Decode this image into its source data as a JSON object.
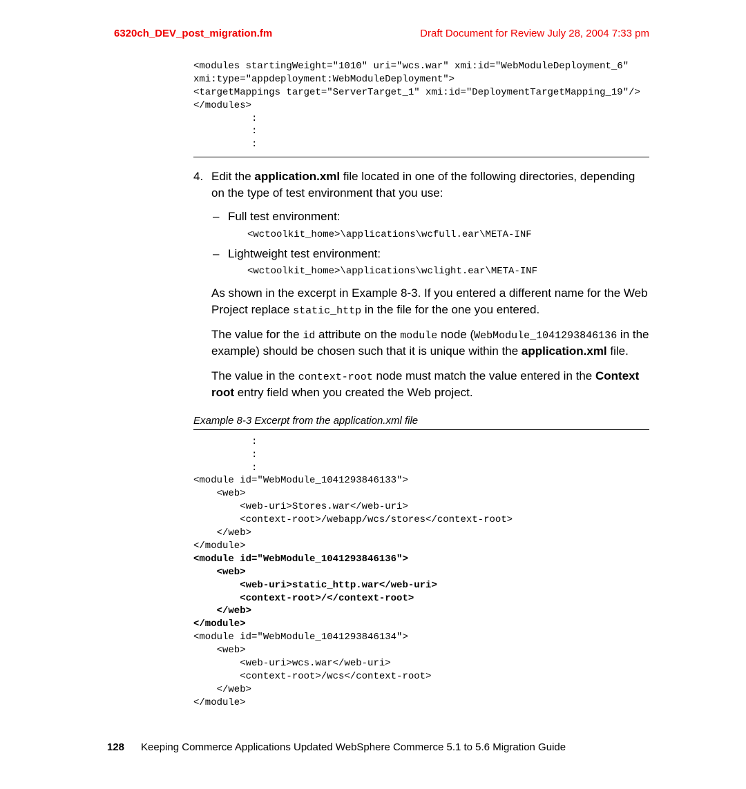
{
  "header": {
    "left": "6320ch_DEV_post_migration.fm",
    "right": "Draft Document for Review July 28, 2004 7:33 pm"
  },
  "code1": {
    "l1": "<modules startingWeight=\"1010\" uri=\"wcs.war\" xmi:id=\"WebModuleDeployment_6\" ",
    "l2": "xmi:type=\"appdeployment:WebModuleDeployment\">",
    "l3": "<targetMappings target=\"ServerTarget_1\" xmi:id=\"DeploymentTargetMapping_19\"/>",
    "l4": "</modules>",
    "d1": "          :",
    "d2": "          :",
    "d3": "          :"
  },
  "step4": {
    "num": "4.",
    "t1": "Edit the ",
    "t1b": "application.xml",
    "t2": " file located in one of the following directories, depending on the type of test environment that you use:"
  },
  "bullet1": {
    "dash": "–",
    "text": "Full test environment:",
    "code": "<wctoolkit_home>\\applications\\wcfull.ear\\META-INF"
  },
  "bullet2": {
    "dash": "–",
    "text": "Lightweight test environment:",
    "code": "<wctoolkit_home>\\applications\\wclight.ear\\META-INF"
  },
  "p1": {
    "t1": "As shown in the excerpt in Example 8-3. If you entered a different name for the Web Project replace ",
    "m1": "static_http",
    "t2": " in the file for the one you entered."
  },
  "p2": {
    "t1": "The value for the ",
    "m1": "id",
    "t2": " attribute on the ",
    "m2": "module",
    "t3": " node (",
    "m3": "WebModule_1041293846136",
    "t4": " in the example) should be chosen such that it is unique within the ",
    "b1": "application.xml",
    "t5": " file."
  },
  "p3": {
    "t1": "The value in the ",
    "m1": "context-root",
    "t2": " node must match the value entered in the ",
    "b1": "Context root",
    "t3": " entry field when you created the Web project."
  },
  "example": {
    "caption": "Example 8-3   Excerpt from the application.xml file"
  },
  "code2": {
    "d1": "          :",
    "d2": "          :",
    "d3": "          :",
    "l1": "<module id=\"WebModule_1041293846133\">",
    "l2": "    <web>",
    "l3": "        <web-uri>Stores.war</web-uri>",
    "l4": "        <context-root>/webapp/wcs/stores</context-root>",
    "l5": "    </web>",
    "l6": "</module>",
    "b1": "<module id=\"WebModule_1041293846136\">",
    "b2": "    <web>",
    "b3": "        <web-uri>static_http.war</web-uri>",
    "b4": "        <context-root>/</context-root>",
    "b5": "    </web>",
    "b6": "</module>",
    "l7": "<module id=\"WebModule_1041293846134\">",
    "l8": "    <web>",
    "l9": "        <web-uri>wcs.war</web-uri>",
    "l10": "        <context-root>/wcs</context-root>",
    "l11": "    </web>",
    "l12": "</module>"
  },
  "footer": {
    "page": "128",
    "text": "Keeping Commerce Applications Updated WebSphere Commerce 5.1 to 5.6 Migration Guide"
  }
}
